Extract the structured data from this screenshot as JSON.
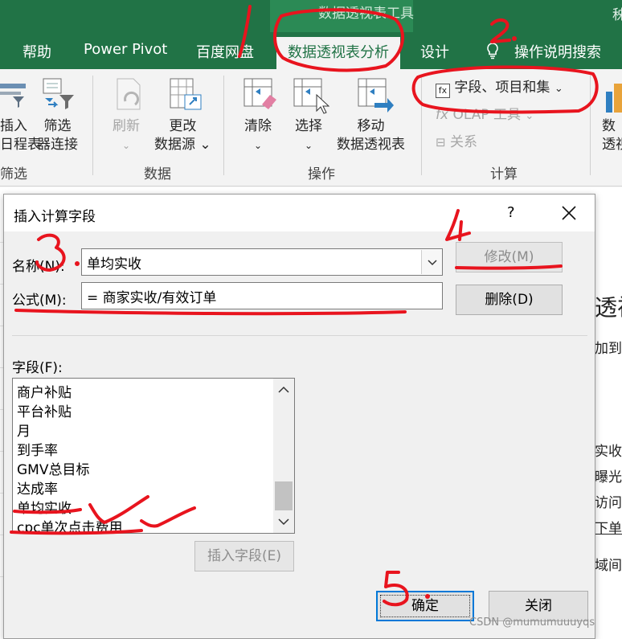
{
  "context_tab_title": "数据透视表工具",
  "right_edge_text": "秭",
  "tabs": [
    {
      "label": "帮助"
    },
    {
      "label": "Power Pivot"
    },
    {
      "label": "百度网盘"
    },
    {
      "label": "数据透视表分析"
    },
    {
      "label": "设计"
    },
    {
      "label": "操作说明搜索"
    }
  ],
  "ribbon": {
    "insert_slicer": [
      "插入",
      "日程表"
    ],
    "filter_conn": [
      "筛选",
      "器连接"
    ],
    "filter_group": "筛选",
    "refresh": "刷新",
    "change_source": [
      "更改",
      "数据源"
    ],
    "data_group": "数据",
    "clear": "清除",
    "select": "选择",
    "move": [
      "移动",
      "数据透视表"
    ],
    "actions_group": "操作",
    "fields_items_sets": "字段、项目和集",
    "olap_tools": "OLAP 工具",
    "relationships": "关系",
    "calc_group": "计算",
    "right_btn": [
      "数",
      "透视"
    ]
  },
  "pane": {
    "heading": "透视",
    "line1": "加到报",
    "items": [
      "实收",
      "曝光量",
      "访问量",
      "下单量",
      "域间"
    ]
  },
  "dialog": {
    "title": "插入计算字段",
    "help": "?",
    "name_label": "名称(N):",
    "name_value": "单均实收",
    "formula_label": "公式(M):",
    "formula_value": "= 商家实收/有效订单",
    "modify_btn": "修改(M)",
    "delete_btn": "删除(D)",
    "fields_label": "字段(F):",
    "fields": [
      "商户补贴",
      "平台补贴",
      "月",
      "到手率",
      "GMV总目标",
      "达成率",
      "单均实收",
      "cpc单次点击费用"
    ],
    "insert_field_btn": "插入字段(E)",
    "ok_btn": "确定",
    "close_btn": "关闭"
  },
  "annotations": [
    "1.",
    "2.",
    "3.",
    "4",
    "5."
  ],
  "watermark": "CSDN @mumumuuuyqs",
  "colors": {
    "ribbon_green": "#217346",
    "annotation_red": "#e8141e",
    "focus_blue": "#0078d7"
  }
}
